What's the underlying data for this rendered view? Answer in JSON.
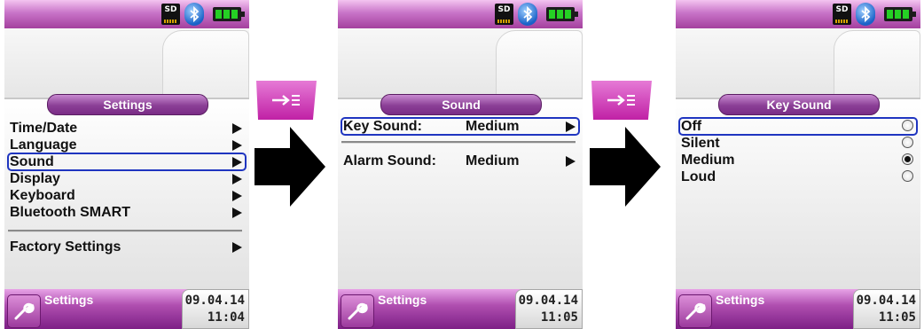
{
  "accent_color": "#a4409e",
  "selection_color": "#1f35c0",
  "status_bar": {
    "sd_label": "SD",
    "icons": [
      "sd-card-icon",
      "bluetooth-icon",
      "battery-icon"
    ]
  },
  "screens": [
    {
      "title": "Settings",
      "softkey_label": "Settings",
      "date": "09.04.14",
      "time": "11:04",
      "items": [
        {
          "label": "Time/Date"
        },
        {
          "label": "Language"
        },
        {
          "label": "Sound",
          "selected": true
        },
        {
          "label": "Display"
        },
        {
          "label": "Keyboard"
        },
        {
          "label": "Bluetooth SMART"
        },
        {
          "label": "Factory Settings"
        }
      ]
    },
    {
      "title": "Sound",
      "softkey_label": "Settings",
      "date": "09.04.14",
      "time": "11:05",
      "items": [
        {
          "label": "Key Sound:",
          "value": "Medium",
          "selected": true
        },
        {
          "label": "Alarm Sound:",
          "value": "Medium"
        }
      ]
    },
    {
      "title": "Key Sound",
      "softkey_label": "Settings",
      "date": "09.04.14",
      "time": "11:05",
      "options": [
        {
          "label": "Off",
          "checked": false,
          "selected": true
        },
        {
          "label": "Silent",
          "checked": false
        },
        {
          "label": "Medium",
          "checked": true
        },
        {
          "label": "Loud",
          "checked": false
        }
      ]
    }
  ],
  "transitions": [
    {
      "key_icon": "enter-key-icon",
      "arrow_icon": "right-arrow-icon"
    },
    {
      "key_icon": "enter-key-icon",
      "arrow_icon": "right-arrow-icon"
    }
  ]
}
